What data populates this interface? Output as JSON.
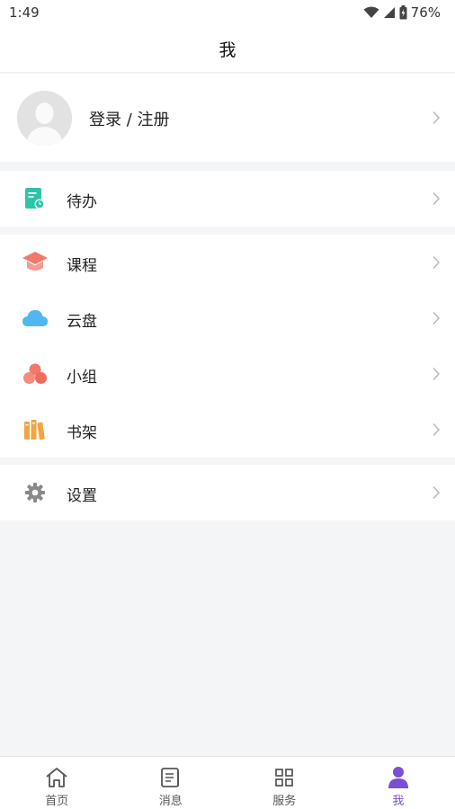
{
  "status_bar": {
    "time": "1:49",
    "battery": "76%"
  },
  "header": {
    "title": "我"
  },
  "profile": {
    "login_label": "登录 / 注册"
  },
  "menu_groups": [
    {
      "items": [
        {
          "label": "待办",
          "icon": "todo-icon",
          "color": "#2ec4a7"
        }
      ]
    },
    {
      "items": [
        {
          "label": "课程",
          "icon": "course-icon",
          "color": "#f2786b"
        },
        {
          "label": "云盘",
          "icon": "cloud-icon",
          "color": "#4fb9ef"
        },
        {
          "label": "小组",
          "icon": "group-icon",
          "color": "#f2786b"
        },
        {
          "label": "书架",
          "icon": "bookshelf-icon",
          "color": "#f2a541"
        }
      ]
    },
    {
      "items": [
        {
          "label": "设置",
          "icon": "gear-icon",
          "color": "#8a8a8a"
        }
      ]
    }
  ],
  "tab_bar": {
    "tabs": [
      {
        "label": "首页",
        "icon": "home-icon",
        "active": false
      },
      {
        "label": "消息",
        "icon": "message-icon",
        "active": false
      },
      {
        "label": "服务",
        "icon": "grid-icon",
        "active": false
      },
      {
        "label": "我",
        "icon": "person-icon",
        "active": true
      }
    ],
    "active_color": "#7a4fd6"
  }
}
